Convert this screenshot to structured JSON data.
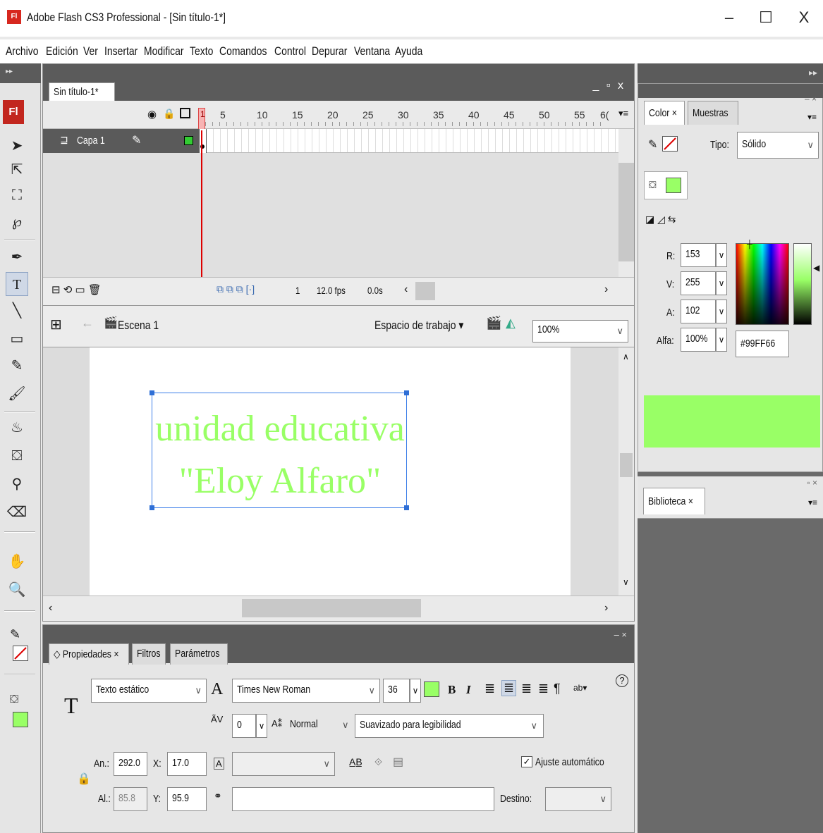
{
  "window": {
    "icon_text": "Fl",
    "title": "Adobe Flash CS3 Professional - [Sin título-1*]",
    "minimize": "–",
    "maximize": "☐",
    "close": "X"
  },
  "menu": [
    "Archivo",
    "Edición",
    "Ver",
    "Insertar",
    "Modificar",
    "Texto",
    "Comandos",
    "Control",
    "Depurar",
    "Ventana",
    "Ayuda"
  ],
  "toolbar": {
    "logo": "Fl",
    "tools": [
      {
        "name": "selection-tool-icon",
        "glyph": "➤"
      },
      {
        "name": "subselection-tool-icon",
        "glyph": "⇱"
      },
      {
        "name": "free-transform-tool-icon",
        "glyph": "⛶"
      },
      {
        "name": "lasso-tool-icon",
        "glyph": "℘"
      },
      {
        "name": "pen-tool-icon",
        "glyph": "✒"
      },
      {
        "name": "text-tool-icon",
        "glyph": "T"
      },
      {
        "name": "line-tool-icon",
        "glyph": "╲"
      },
      {
        "name": "rectangle-tool-icon",
        "glyph": "▭"
      },
      {
        "name": "pencil-tool-icon",
        "glyph": "✎"
      },
      {
        "name": "brush-tool-icon",
        "glyph": "🖌"
      },
      {
        "name": "ink-bottle-tool-icon",
        "glyph": "♨"
      },
      {
        "name": "paint-bucket-tool-icon",
        "glyph": "⛋"
      },
      {
        "name": "eyedropper-tool-icon",
        "glyph": "⚲"
      },
      {
        "name": "eraser-tool-icon",
        "glyph": "⌫"
      },
      {
        "name": "hand-tool-icon",
        "glyph": "✋"
      },
      {
        "name": "zoom-tool-icon",
        "glyph": "🔍"
      }
    ]
  },
  "document": {
    "tab": "Sin título-1*",
    "window_controls": "_ ▫ x"
  },
  "timeline": {
    "frame_numbers": [
      "1",
      "5",
      "10",
      "15",
      "20",
      "25",
      "30",
      "35",
      "40",
      "45",
      "50",
      "55",
      "6("
    ],
    "layer_name": "Capa 1",
    "current_frame": "1",
    "fps": "12.0 fps",
    "time": "0.0s"
  },
  "editbar": {
    "scene": "Escena 1",
    "workspace": "Espacio de trabajo ▾",
    "zoom": "100%"
  },
  "stage": {
    "line1": "unidad educativa",
    "line2": "\"Eloy Alfaro\""
  },
  "properties": {
    "tabs": [
      "◇ Propiedades ×",
      "Filtros",
      "Parámetros"
    ],
    "text_type": "Texto estático",
    "font": "Times New Roman",
    "size": "36",
    "letter_spacing": "0",
    "baseline": "Normal",
    "antialias": "Suavizado para legibilidad",
    "width_label": "An.:",
    "width": "292.0",
    "x_label": "X:",
    "x": "17.0",
    "height_label": "Al.:",
    "height": "85.8",
    "y_label": "Y:",
    "y": "95.9",
    "autokern": "Ajuste automático",
    "target_label": "Destino:",
    "help": "?"
  },
  "color_panel": {
    "tabs": [
      "Color ×",
      "Muestras"
    ],
    "type_label": "Tipo:",
    "type_value": "Sólido",
    "r_label": "R:",
    "r": "153",
    "g_label": "V:",
    "g": "255",
    "b_label": "A:",
    "b": "102",
    "alpha_label": "Alfa:",
    "alpha": "100%",
    "hex": "#99FF66"
  },
  "library": {
    "tab": "Biblioteca ×"
  },
  "colors": {
    "text_color": "#99ff66",
    "selection_blue": "#3c7ee8",
    "playhead_red": "#dd0000",
    "panel_dark": "#5b5b5b"
  }
}
